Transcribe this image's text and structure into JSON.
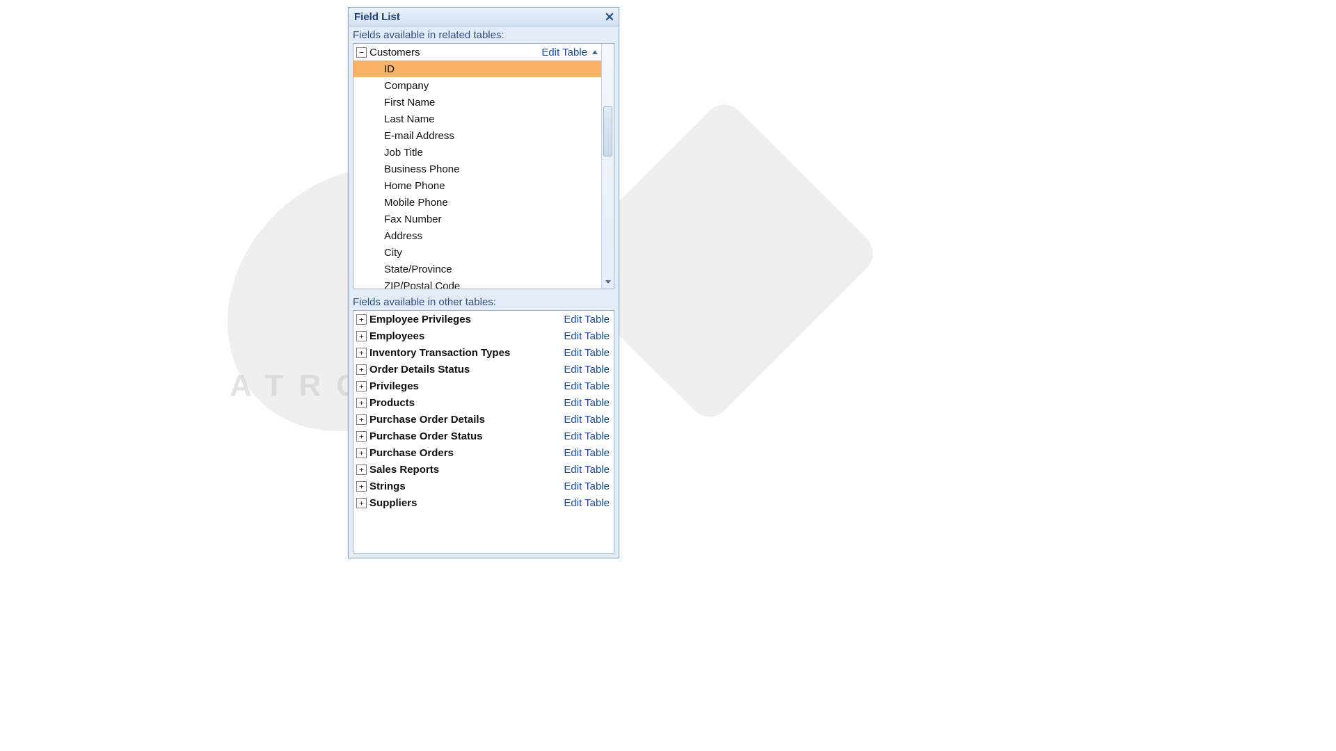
{
  "watermark_text": "ATRO   ADEMY",
  "panel": {
    "title": "Field List",
    "section_related_label": "Fields available in related tables:",
    "section_other_label": "Fields available in other tables:",
    "edit_table_label": "Edit Table",
    "related_table": {
      "name": "Customers",
      "expanded": true,
      "selected_field_index": 0,
      "fields": [
        "ID",
        "Company",
        "First Name",
        "Last Name",
        "E-mail Address",
        "Job Title",
        "Business Phone",
        "Home Phone",
        "Mobile Phone",
        "Fax Number",
        "Address",
        "City",
        "State/Province",
        "ZIP/Postal Code"
      ]
    },
    "other_tables": [
      "Employee Privileges",
      "Employees",
      "Inventory Transaction Types",
      "Order Details Status",
      "Privileges",
      "Products",
      "Purchase Order Details",
      "Purchase Order Status",
      "Purchase Orders",
      "Sales Reports",
      "Strings",
      "Suppliers"
    ]
  }
}
